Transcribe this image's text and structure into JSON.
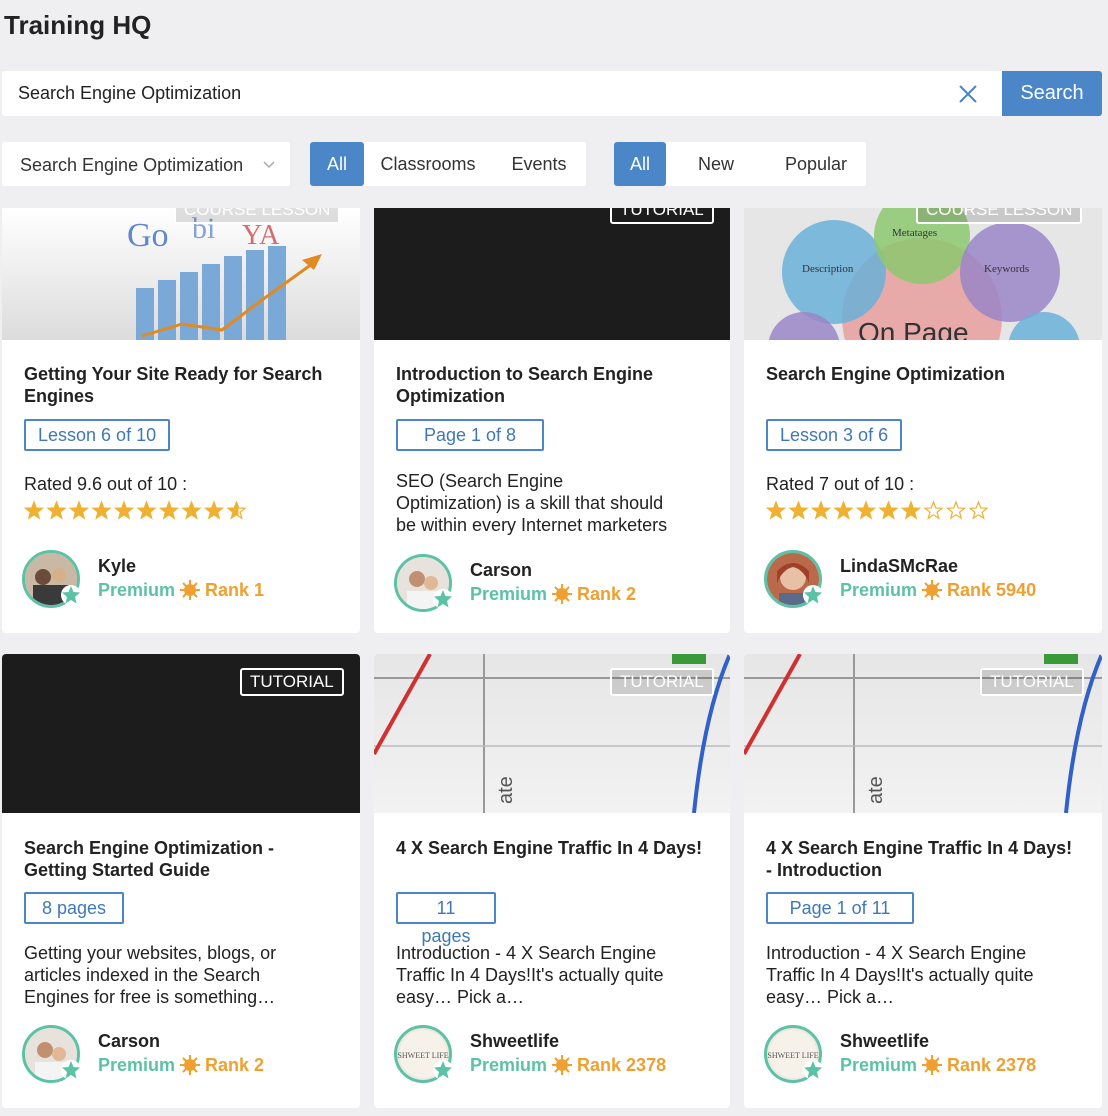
{
  "app": {
    "title": "Training HQ"
  },
  "search": {
    "value": "Search Engine Optimization",
    "button": "Search"
  },
  "filters": {
    "category": "Search Engine Optimization",
    "type_tabs": [
      "All",
      "Classrooms",
      "Events"
    ],
    "sort_tabs": [
      "All",
      "New",
      "Popular"
    ]
  },
  "colors": {
    "accent": "#4a86c8",
    "premium": "#5cc2a6",
    "rank": "#f0a030"
  },
  "cards": [
    {
      "badge": "COURSE LESSON",
      "title": "Getting Your Site Ready for Search Engines",
      "pill": "Lesson 6 of 10",
      "rating_text": "Rated 9.6 out of 10 :",
      "rating": 9.6,
      "author": "Kyle",
      "membership": "Premium",
      "rank": "Rank 1"
    },
    {
      "badge": "TUTORIAL",
      "title": "Introduction to Search Engine Optimization",
      "pill": "Page 1 of 8",
      "description": "SEO (Search Engine Optimization) is a skill that should be within every Internet marketers arsenal...",
      "author": "Carson",
      "membership": "Premium",
      "rank": "Rank 2"
    },
    {
      "badge": "COURSE LESSON",
      "title": "Search Engine Optimization",
      "pill": "Lesson 3 of 6",
      "rating_text": "Rated 7 out of 10 :",
      "rating": 7,
      "author": "LindaSMcRae",
      "membership": "Premium",
      "rank": "Rank 5940",
      "thumb_labels": [
        "Metatages",
        "Description",
        "Keywords",
        "On Page"
      ]
    },
    {
      "badge": "TUTORIAL",
      "title": "Search Engine Optimization - Getting Started Guide",
      "pill": "8 pages",
      "description": "Getting your websites, blogs, or articles indexed in the Search Engines for free is something…",
      "author": "Carson",
      "membership": "Premium",
      "rank": "Rank 2"
    },
    {
      "badge": "TUTORIAL",
      "title": "4 X Search Engine Traffic In 4 Days!",
      "pill": "11 pages",
      "description": "Introduction - 4 X Search Engine Traffic In 4 Days!It's actually quite easy… Pick a…",
      "author": "Shweetlife",
      "membership": "Premium",
      "rank": "Rank 2378"
    },
    {
      "badge": "TUTORIAL",
      "title": "4 X Search Engine Traffic In 4 Days! - Introduction",
      "pill": "Page 1 of 11",
      "description": "Introduction - 4 X Search Engine Traffic In 4 Days!It's actually quite easy… Pick a…",
      "author": "Shweetlife",
      "membership": "Premium",
      "rank": "Rank 2378"
    }
  ]
}
